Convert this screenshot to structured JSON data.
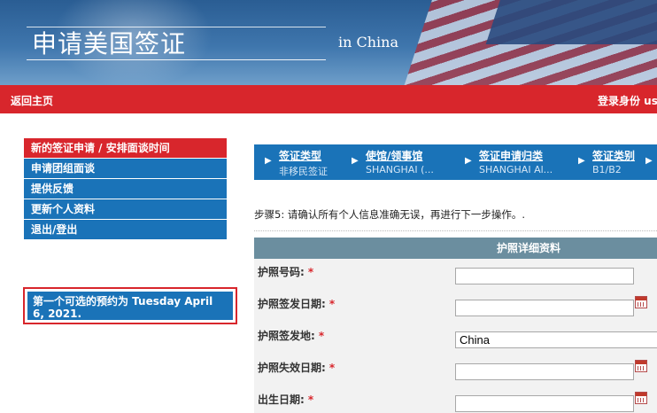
{
  "banner": {
    "title": "申请美国签证",
    "subtitle": "in China"
  },
  "navbar": {
    "home_label": "返回主页",
    "login_label": "登录身份  us"
  },
  "side_menu": {
    "items": [
      {
        "label": "新的签证申请 / 安排面谈时间",
        "active": true
      },
      {
        "label": "申请团组面谈",
        "active": false
      },
      {
        "label": "提供反馈",
        "active": false
      },
      {
        "label": "更新个人资料",
        "active": false
      },
      {
        "label": "退出/登出",
        "active": false
      }
    ]
  },
  "notice": {
    "text": "第一个可选的预约为 Tuesday April 6, 2021."
  },
  "steps": [
    {
      "label": "签证类型",
      "value": "非移民签证"
    },
    {
      "label": "使馆/领事馆",
      "value": "SHANGHAI (..."
    },
    {
      "label": "签证申请归类",
      "value": "SHANGHAI Al..."
    },
    {
      "label": "签证类别",
      "value": "B1/B2"
    }
  ],
  "instruction": "步骤5: 请确认所有个人信息准确无误，再进行下一步操作。.",
  "form": {
    "section_title": "护照详细资料",
    "required_mark": "*",
    "fields": [
      {
        "label": "护照号码:",
        "value": "",
        "has_calendar": false
      },
      {
        "label": "护照签发日期:",
        "value": "",
        "has_calendar": true
      },
      {
        "label": "护照签发地:",
        "value": "China",
        "has_calendar": false
      },
      {
        "label": "护照失效日期:",
        "value": "",
        "has_calendar": true
      },
      {
        "label": "出生日期:",
        "value": "",
        "has_calendar": true
      }
    ]
  },
  "colors": {
    "brand_red": "#d8262c",
    "brand_blue": "#1a73b8",
    "form_header": "#6b8e9f"
  },
  "icons": {
    "calendar": "calendar-icon",
    "step_arrow": "chevron-right-icon"
  }
}
